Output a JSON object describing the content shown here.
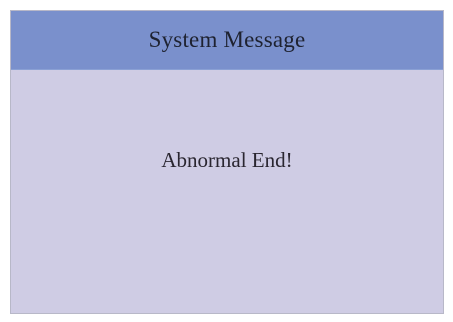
{
  "dialog": {
    "title": "System Message",
    "message": "Abnormal End!"
  },
  "colors": {
    "title_bar": "#7a90cc",
    "body": "#cfcce4",
    "text": "#1e2230"
  }
}
